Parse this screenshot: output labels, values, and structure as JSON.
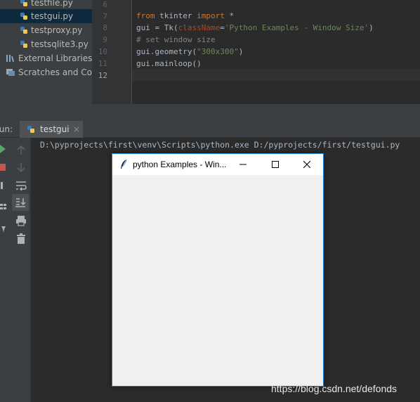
{
  "project_tree": {
    "items": [
      {
        "label": "testfile.py",
        "type": "python-file"
      },
      {
        "label": "testgui.py",
        "type": "python-file",
        "selected": true
      },
      {
        "label": "testproxy.py",
        "type": "python-file"
      },
      {
        "label": "testsqlite3.py",
        "type": "python-file"
      },
      {
        "label": "External Libraries",
        "type": "library"
      },
      {
        "label": "Scratches and Consoles",
        "type": "scratches"
      }
    ]
  },
  "editor": {
    "line_numbers": [
      "6",
      "7",
      "8",
      "9",
      "10",
      "11",
      "12"
    ],
    "current_line": "12",
    "code": {
      "line7": {
        "kw1": "from",
        "mid": " tkinter ",
        "kw2": "import",
        "end": " *"
      },
      "line8": {
        "pre": "gui = Tk(",
        "param": "className",
        "eq": "=",
        "str": "'Python Examples - Window Size'",
        "end": ")"
      },
      "line9": {
        "comment": "# set window size"
      },
      "line10": {
        "pre": "gui.geometry(",
        "str": "\"300x300\"",
        "end": ")"
      },
      "line11": {
        "text": "gui.mainloop()"
      }
    }
  },
  "run_panel": {
    "label": "Run:",
    "tab_label": "testgui",
    "tab_close": "×",
    "console_command": "D:\\pyprojects\\first\\venv\\Scripts\\python.exe D:/pyprojects/first/testgui.py"
  },
  "tk_window": {
    "title": "python Examples - Win...",
    "icon": "feather-icon",
    "controls": [
      "minimize-icon",
      "maximize-icon",
      "close-icon"
    ]
  },
  "watermark": "https://blog.csdn.net/defonds",
  "colors": {
    "keyword": "#cc7832",
    "string": "#6a8759",
    "comment": "#808080",
    "param": "#aa4926",
    "window_border": "#1883d7"
  }
}
